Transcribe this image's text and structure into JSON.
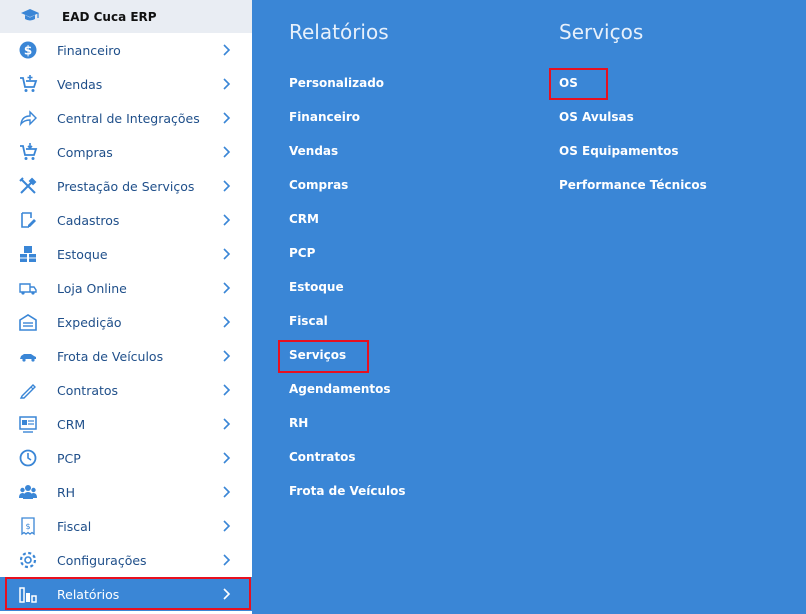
{
  "sidebar": {
    "brand": {
      "label": "EAD Cuca ERP",
      "icon": "graduation-cap-icon"
    },
    "items": [
      {
        "label": "Financeiro",
        "icon": "dollar-icon"
      },
      {
        "label": "Vendas",
        "icon": "cart-add-icon"
      },
      {
        "label": "Central de Integrações",
        "icon": "share-arrow-icon"
      },
      {
        "label": "Compras",
        "icon": "cart-down-icon"
      },
      {
        "label": "Prestação de Serviços",
        "icon": "tools-icon"
      },
      {
        "label": "Cadastros",
        "icon": "edit-icon"
      },
      {
        "label": "Estoque",
        "icon": "boxes-icon"
      },
      {
        "label": "Loja Online",
        "icon": "delivery-truck-icon"
      },
      {
        "label": "Expedição",
        "icon": "warehouse-icon"
      },
      {
        "label": "Frota de Veículos",
        "icon": "car-icon"
      },
      {
        "label": "Contratos",
        "icon": "pen-icon"
      },
      {
        "label": "CRM",
        "icon": "id-card-icon"
      },
      {
        "label": "PCP",
        "icon": "clock-icon"
      },
      {
        "label": "RH",
        "icon": "users-icon"
      },
      {
        "label": "Fiscal",
        "icon": "receipt-icon"
      },
      {
        "label": "Configurações",
        "icon": "gear-icon"
      },
      {
        "label": "Relatórios",
        "icon": "bar-chart-icon",
        "active": true
      }
    ]
  },
  "relatorios": {
    "title": "Relatórios",
    "links": [
      "Personalizado",
      "Financeiro",
      "Vendas",
      "Compras",
      "CRM",
      "PCP",
      "Estoque",
      "Fiscal",
      "Serviços",
      "Agendamentos",
      "RH",
      "Contratos",
      "Frota de Veículos"
    ]
  },
  "servicos": {
    "title": "Serviços",
    "links": [
      "OS",
      "OS Avulsas",
      "OS Equipamentos",
      "Performance Técnicos"
    ]
  },
  "colors": {
    "panel_blue": "#3a86d6",
    "sidebar_text": "#1f4f8a",
    "highlight_red": "#e8101f",
    "icon_blue": "#3a86d6"
  }
}
